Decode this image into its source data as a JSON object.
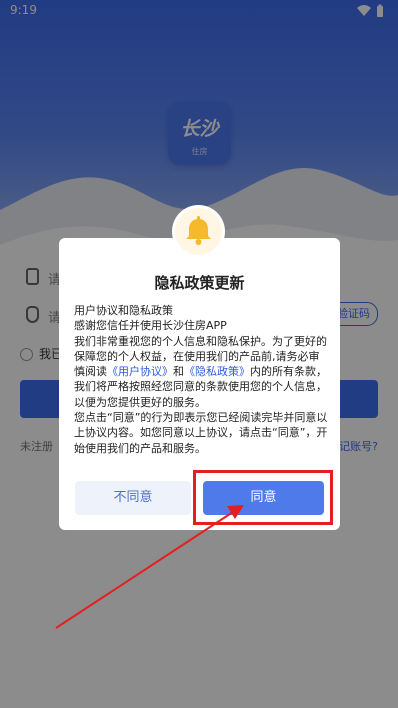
{
  "status_bar": {
    "time": "9:19"
  },
  "app": {
    "logo_main": "长沙",
    "logo_sub": "住房",
    "phone_placeholder": "请",
    "code_placeholder": "请",
    "verify_label": "取验证码",
    "agree_text": "我已",
    "links_left": "未注册",
    "links_right": "记账号?"
  },
  "dialog": {
    "title": "隐私政策更新",
    "line1": "用户协议和隐私政策",
    "line2": "感谢您信任并使用长沙住房APP",
    "para_a": "我们非常重视您的个人信息和隐私保护。为了更好的保障您的个人权益，在使用我们的产品前,请务必审慎阅读",
    "link_user": "《用户协议》",
    "and": "和",
    "link_privacy": "《隐私政策》",
    "para_b": "内的所有条款，我们将严格按照经您同意的条款使用您的个人信息，以便为您提供更好的服务。",
    "para_c": "您点击“同意”的行为即表示您已经阅读完毕并同意以上协议内容。如您同意以上协议，请点击“同意”，开始使用我们的产品和服务。",
    "cancel_label": "不同意",
    "ok_label": "同意"
  },
  "colors": {
    "primary": "#3e6df0",
    "ok_button": "#4f7bea",
    "highlight": "#e51f1f",
    "bell": "#f6b92b"
  }
}
